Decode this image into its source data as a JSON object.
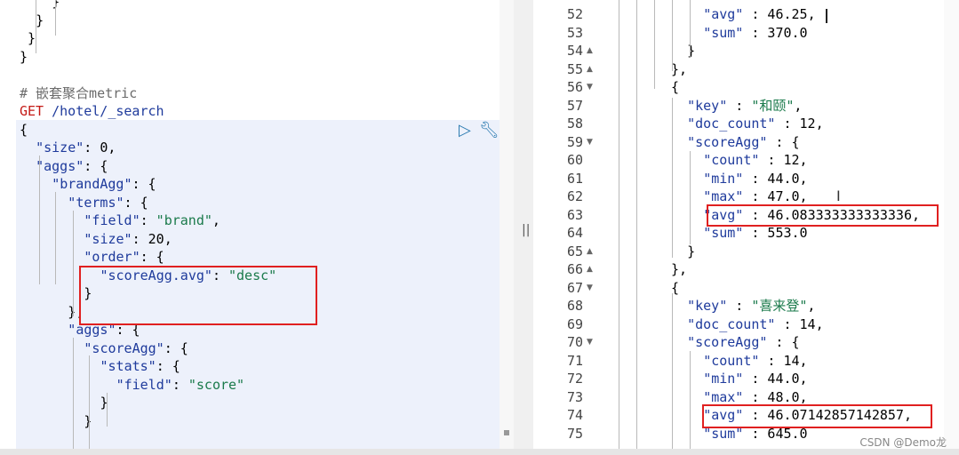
{
  "left_editor": {
    "lines": [
      {
        "indent": "    ",
        "text": "}"
      },
      {
        "indent": "  ",
        "text": "}"
      },
      {
        "indent": " ",
        "text": "}"
      },
      {
        "indent": "",
        "text": "}"
      },
      {
        "indent": "",
        "text": ""
      },
      {
        "indent": "",
        "text": "# 嵌套聚合metric"
      },
      {
        "indent": "",
        "text": "GET /hotel/_search"
      },
      {
        "indent": "",
        "text": "{"
      },
      {
        "indent": "  ",
        "text": "\"size\": 0,"
      },
      {
        "indent": "  ",
        "text": "\"aggs\": {"
      },
      {
        "indent": "    ",
        "text": "\"brandAgg\": {"
      },
      {
        "indent": "      ",
        "text": "\"terms\": {"
      },
      {
        "indent": "        ",
        "text": "\"field\": \"brand\","
      },
      {
        "indent": "        ",
        "text": "\"size\": 20,"
      },
      {
        "indent": "        ",
        "text": "\"order\": {"
      },
      {
        "indent": "          ",
        "text": "\"scoreAgg.avg\": \"desc\""
      },
      {
        "indent": "        ",
        "text": "}"
      },
      {
        "indent": "      ",
        "text": "},"
      },
      {
        "indent": "      ",
        "text": "\"aggs\": {"
      },
      {
        "indent": "        ",
        "text": "\"scoreAgg\": {"
      },
      {
        "indent": "          ",
        "text": "\"stats\": {"
      },
      {
        "indent": "            ",
        "text": "\"field\": \"score\""
      },
      {
        "indent": "          ",
        "text": "}"
      },
      {
        "indent": "        ",
        "text": "}"
      }
    ],
    "comment": "# 嵌套聚合metric",
    "request_method": "GET",
    "request_path": "/hotel/_search",
    "run_icon": "play-icon",
    "wrench_icon": "wrench-icon"
  },
  "right_editor": {
    "lines": [
      {
        "num": "52",
        "fold": "",
        "indent": "          ",
        "text": "\"avg\" : 46.25,"
      },
      {
        "num": "53",
        "fold": "",
        "indent": "          ",
        "text": "\"sum\" : 370.0"
      },
      {
        "num": "54",
        "fold": "▲",
        "indent": "        ",
        "text": "}"
      },
      {
        "num": "55",
        "fold": "▲",
        "indent": "      ",
        "text": "},"
      },
      {
        "num": "56",
        "fold": "▼",
        "indent": "      ",
        "text": "{"
      },
      {
        "num": "57",
        "fold": "",
        "indent": "        ",
        "text": "\"key\" : \"和颐\","
      },
      {
        "num": "58",
        "fold": "",
        "indent": "        ",
        "text": "\"doc_count\" : 12,"
      },
      {
        "num": "59",
        "fold": "▼",
        "indent": "        ",
        "text": "\"scoreAgg\" : {"
      },
      {
        "num": "60",
        "fold": "",
        "indent": "          ",
        "text": "\"count\" : 12,"
      },
      {
        "num": "61",
        "fold": "",
        "indent": "          ",
        "text": "\"min\" : 44.0,"
      },
      {
        "num": "62",
        "fold": "",
        "indent": "          ",
        "text": "\"max\" : 47.0,"
      },
      {
        "num": "63",
        "fold": "",
        "indent": "          ",
        "text": "\"avg\" : 46.083333333333336,"
      },
      {
        "num": "64",
        "fold": "",
        "indent": "          ",
        "text": "\"sum\" : 553.0"
      },
      {
        "num": "65",
        "fold": "▲",
        "indent": "        ",
        "text": "}"
      },
      {
        "num": "66",
        "fold": "▲",
        "indent": "      ",
        "text": "},"
      },
      {
        "num": "67",
        "fold": "▼",
        "indent": "      ",
        "text": "{"
      },
      {
        "num": "68",
        "fold": "",
        "indent": "        ",
        "text": "\"key\" : \"喜来登\","
      },
      {
        "num": "69",
        "fold": "",
        "indent": "        ",
        "text": "\"doc_count\" : 14,"
      },
      {
        "num": "70",
        "fold": "▼",
        "indent": "        ",
        "text": "\"scoreAgg\" : {"
      },
      {
        "num": "71",
        "fold": "",
        "indent": "          ",
        "text": "\"count\" : 14,"
      },
      {
        "num": "72",
        "fold": "",
        "indent": "          ",
        "text": "\"min\" : 44.0,"
      },
      {
        "num": "73",
        "fold": "",
        "indent": "          ",
        "text": "\"max\" : 48.0,"
      },
      {
        "num": "74",
        "fold": "",
        "indent": "          ",
        "text": "\"avg\" : 46.07142857142857,"
      },
      {
        "num": "75",
        "fold": "",
        "indent": "          ",
        "text": "\"sum\" : 645.0"
      }
    ]
  },
  "divider_icon": "resize-handle-icon",
  "watermark": "CSDN @Demo龙"
}
